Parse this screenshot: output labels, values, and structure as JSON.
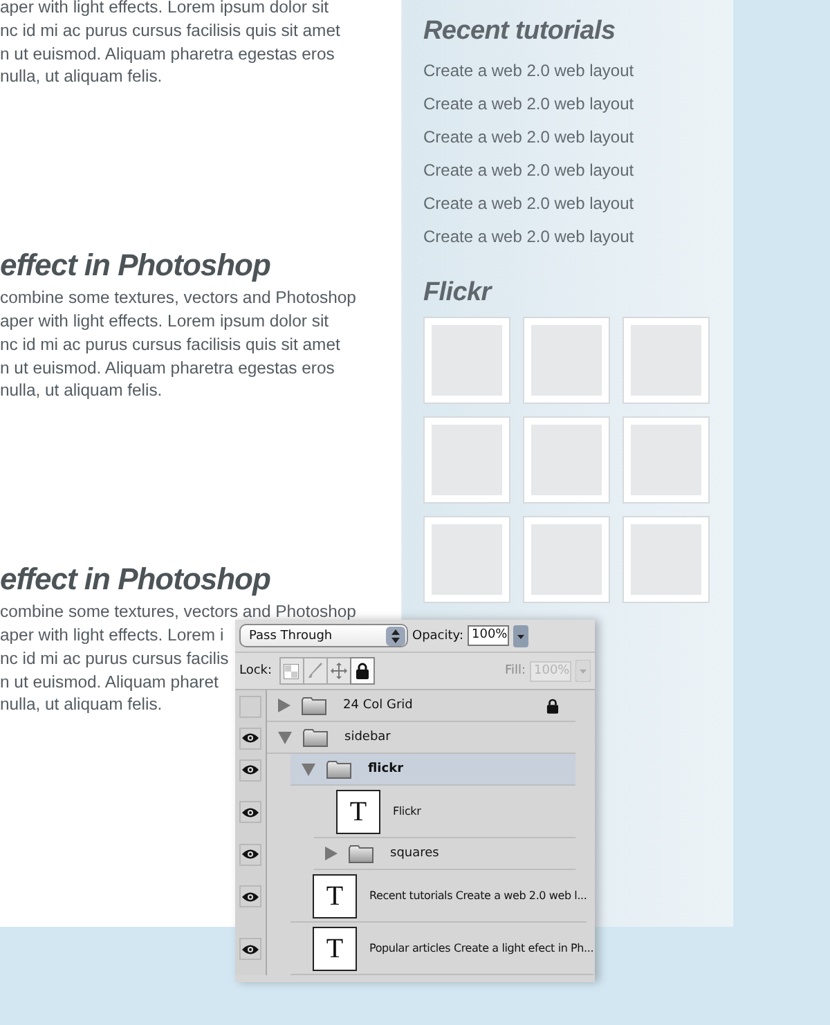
{
  "article": {
    "blocks": [
      {
        "lines": [
          "aper with light effects. Lorem ipsum dolor sit",
          "nc id mi ac purus cursus facilisis quis sit amet",
          "n ut euismod. Aliquam pharetra egestas eros",
          "nulla, ut aliquam felis."
        ]
      },
      {
        "heading": "effect in Photoshop",
        "lines": [
          "combine some textures, vectors and Photoshop",
          "aper with light effects. Lorem ipsum dolor sit",
          "nc id mi ac purus cursus facilisis quis sit amet",
          "n ut euismod. Aliquam pharetra egestas eros",
          "nulla, ut aliquam felis."
        ]
      },
      {
        "heading": "effect in Photoshop",
        "lines": [
          "combine some textures, vectors and Photoshop",
          "aper with light effects. Lorem i",
          "nc id mi ac purus cursus facilis",
          "n ut euismod. Aliquam pharet",
          "nulla, ut aliquam felis."
        ]
      }
    ]
  },
  "sidebar": {
    "recent": {
      "title": "Recent tutorials",
      "links": [
        "Create a web 2.0 web layout",
        "Create a web 2.0 web layout",
        "Create a web 2.0 web layout",
        "Create a web 2.0 web layout",
        "Create a web 2.0 web layout",
        "Create a web 2.0 web layout"
      ]
    },
    "flickr": {
      "title": "Flickr",
      "thumbnails": [
        {
          "kind": "placeholder"
        },
        {
          "kind": "placeholder"
        },
        {
          "kind": "placeholder"
        },
        {
          "kind": "placeholder"
        },
        {
          "kind": "placeholder"
        },
        {
          "kind": "placeholder"
        },
        {
          "kind": "placeholder"
        },
        {
          "kind": "placeholder"
        },
        {
          "kind": "placeholder"
        }
      ]
    }
  },
  "layers_panel": {
    "blend_mode": "Pass Through",
    "opacity_label": "Opacity:",
    "opacity": "100%",
    "lock_label": "Lock:",
    "locks": [
      {
        "kind": "transparency",
        "selected": false
      },
      {
        "kind": "paint",
        "selected": false
      },
      {
        "kind": "position",
        "selected": false
      },
      {
        "kind": "all",
        "selected": true
      }
    ],
    "fill_label": "Fill:",
    "fill": "100%",
    "fill_disabled": true,
    "layers": [
      {
        "kind": "group",
        "name": "24 Col Grid",
        "visible": false,
        "expanded": false,
        "locked": true,
        "selected": false
      },
      {
        "kind": "group",
        "name": "sidebar",
        "visible": true,
        "expanded": true,
        "locked": false,
        "selected": false,
        "children": [
          {
            "kind": "group",
            "name": "flickr",
            "visible": true,
            "expanded": true,
            "locked": false,
            "selected": true,
            "children": [
              {
                "kind": "text",
                "name": "Flickr",
                "thumbnail": "T",
                "visible": true,
                "locked": false,
                "selected": false
              },
              {
                "kind": "group",
                "name": "squares",
                "visible": true,
                "expanded": false,
                "locked": false,
                "selected": false
              }
            ]
          },
          {
            "kind": "text",
            "name": "Recent tutorials Create a web 2.0 web l...",
            "thumbnail": "T",
            "visible": true,
            "locked": false,
            "selected": false
          },
          {
            "kind": "text",
            "name": "Popular articles Create a light efect in Ph...",
            "thumbnail": "T",
            "visible": true,
            "locked": false,
            "selected": false
          }
        ]
      }
    ]
  }
}
